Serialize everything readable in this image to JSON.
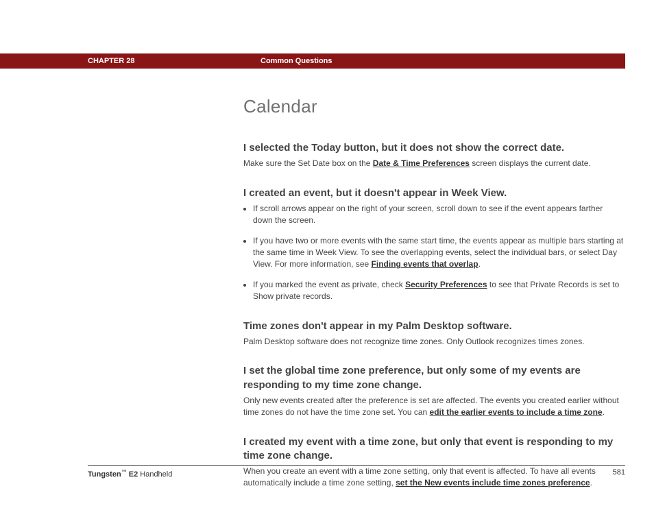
{
  "header": {
    "chapter": "CHAPTER 28",
    "section": "Common Questions"
  },
  "title": "Calendar",
  "q1": {
    "heading": "I selected the Today button, but it does not show the correct date.",
    "text_before": "Make sure the Set Date box on the ",
    "link": "Date & Time Preferences",
    "text_after": " screen displays the current date."
  },
  "q2": {
    "heading": "I created an event, but it doesn't appear in Week View.",
    "bullet1": "If scroll arrows appear on the right of your screen, scroll down to see if the event appears farther down the screen.",
    "bullet2_before": "If you have two or more events with the same start time, the events appear as multiple bars starting at the same time in Week View. To see the overlapping events, select the individual bars, or select Day View. For more information, see ",
    "bullet2_link": "Finding events that overlap",
    "bullet2_after": ".",
    "bullet3_before": "If you marked the event as private, check ",
    "bullet3_link": "Security Preferences",
    "bullet3_after": " to see that Private Records is set to Show private records."
  },
  "q3": {
    "heading": "Time zones don't appear in my Palm Desktop software.",
    "text": "Palm Desktop software does not recognize time zones. Only Outlook recognizes times zones."
  },
  "q4": {
    "heading": "I set the global time zone preference, but only some of my events are responding to my time zone change.",
    "text_before": "Only new events created after the preference is set are affected. The events you created earlier without time zones do not have the time zone set. You can ",
    "link": "edit the earlier events to include a time zone",
    "text_after": "."
  },
  "q5": {
    "heading": "I created my event with a time zone, but only that event is responding to my time zone change.",
    "text_before": "When you create an event with a time zone setting, only that event is affected. To have all events automatically include a time zone setting, ",
    "link": "set the New events include time zones preference",
    "text_after": "."
  },
  "footer": {
    "product_bold": "Tungsten",
    "product_tm": "™",
    "product_model": " E2",
    "product_rest": " Handheld",
    "page": "581"
  }
}
